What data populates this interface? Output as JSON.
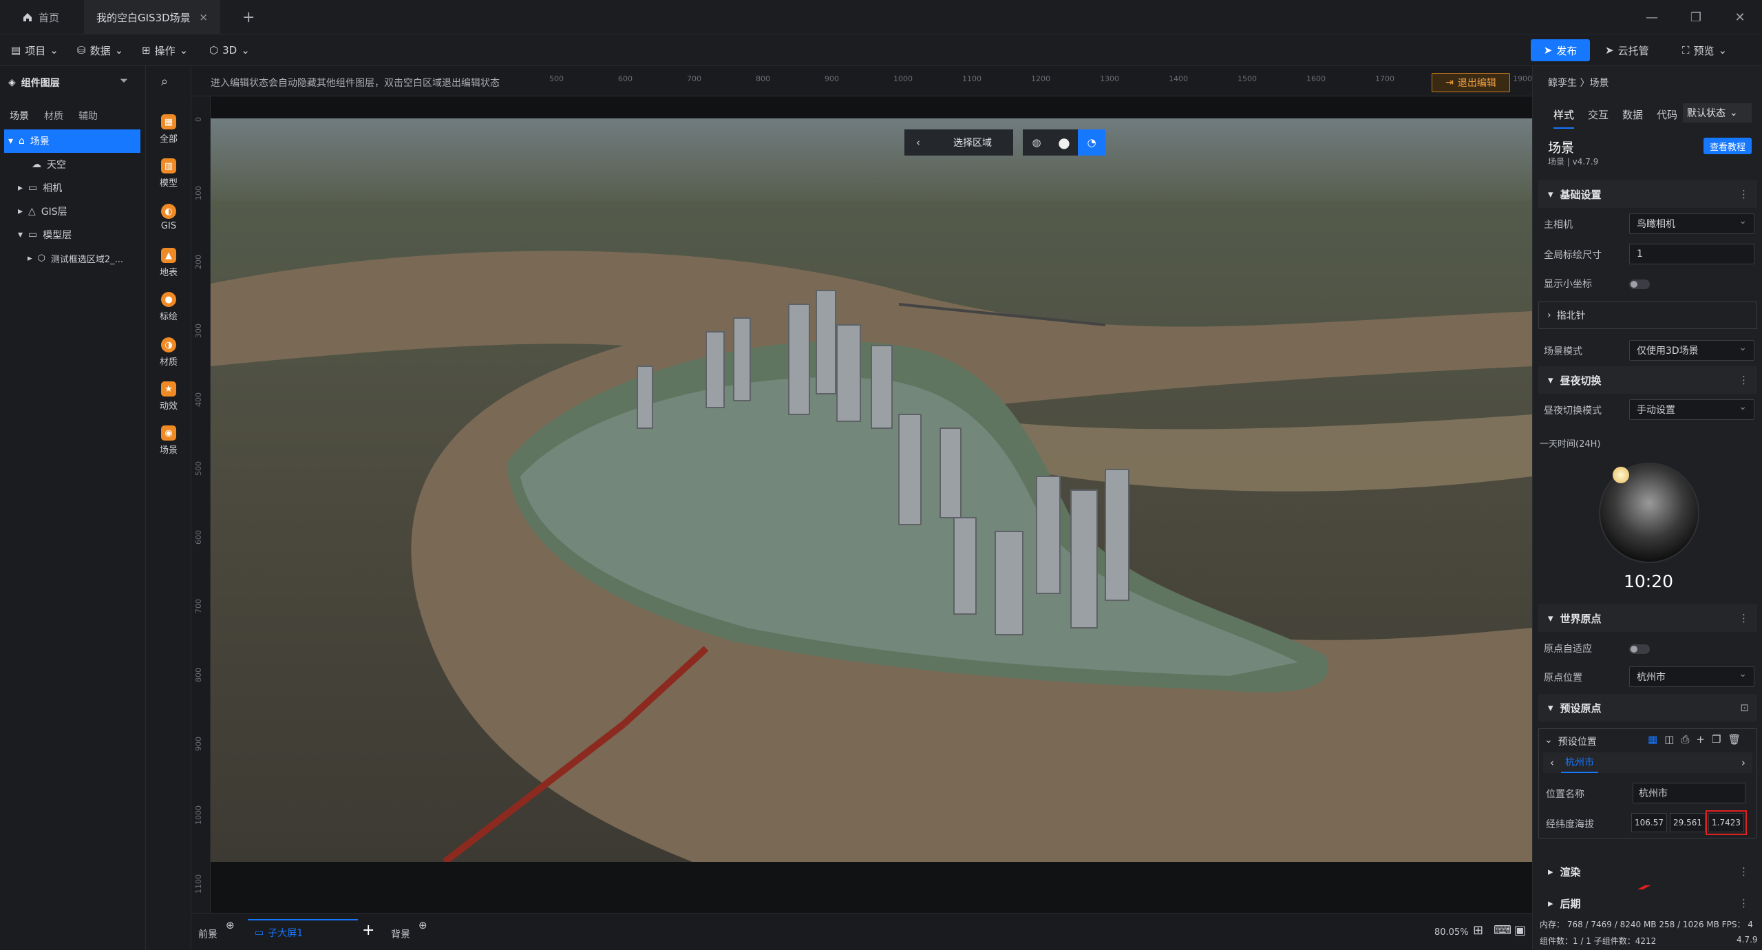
{
  "titlebar": {
    "tabs": [
      {
        "label": "首页"
      },
      {
        "label": "我的空白GIS3D场景"
      }
    ],
    "add_tab": "+"
  },
  "menubar": {
    "items": [
      {
        "label": "项目"
      },
      {
        "label": "数据"
      },
      {
        "label": "操作"
      },
      {
        "label": "3D"
      }
    ],
    "publish": "发布",
    "cloud": "云托管",
    "preview": "预览"
  },
  "left": {
    "title": "组件图层",
    "tabs": [
      "场景",
      "材质",
      "辅助"
    ],
    "tree": [
      {
        "label": "场景"
      },
      {
        "label": "天空"
      },
      {
        "label": "相机"
      },
      {
        "label": "GIS层"
      },
      {
        "label": "模型层"
      },
      {
        "label": "测试框选区域2_..."
      }
    ]
  },
  "iconbar": [
    {
      "label": "全部",
      "icon": "grid-icon"
    },
    {
      "label": "模型",
      "icon": "model-icon"
    },
    {
      "label": "GIS",
      "icon": "gis-icon"
    },
    {
      "label": "地表",
      "icon": "terrain-icon"
    },
    {
      "label": "标绘",
      "icon": "marker-icon"
    },
    {
      "label": "材质",
      "icon": "material-icon"
    },
    {
      "label": "动效",
      "icon": "effect-icon"
    },
    {
      "label": "场景",
      "icon": "scene-icon"
    }
  ],
  "canvas": {
    "hint": "进入编辑状态会自动隐藏其他组件图层，双击空白区域退出编辑状态",
    "exit_edit": "退出编辑",
    "select_area": "选择区域",
    "ruler_top": [
      "500",
      "600",
      "700",
      "800",
      "900",
      "1000",
      "1100",
      "1200",
      "1300",
      "1400",
      "1500",
      "1600",
      "1700",
      "1800",
      "1900"
    ],
    "ruler_left": [
      "0",
      "100",
      "200",
      "300",
      "400",
      "500",
      "600",
      "700",
      "800",
      "900",
      "1000",
      "1100"
    ]
  },
  "bottom": {
    "foreground": "前景",
    "screen": "子大屏1",
    "background": "背景",
    "zoom": "80.05%"
  },
  "right": {
    "breadcrumb": "鲸孪生 〉场景",
    "tabs": [
      "样式",
      "交互",
      "数据",
      "代码"
    ],
    "state": "默认状态",
    "title": "场景",
    "version": "场景 | v4.7.9",
    "tutorial": "查看教程",
    "sections": {
      "basic": "基础设置",
      "daynight": "昼夜切换",
      "world_origin": "世界原点",
      "preset_origin": "预设原点",
      "render": "渲染",
      "post": "后期"
    },
    "fields": {
      "main_camera_label": "主相机",
      "main_camera": "鸟瞰相机",
      "label_size_label": "全局标绘尺寸",
      "label_size": "1",
      "show_axis_label": "显示小坐标",
      "compass": "指北针",
      "scene_mode_label": "场景模式",
      "scene_mode": "仅使用3D场景",
      "daynight_mode_label": "昼夜切换模式",
      "daynight_mode": "手动设置",
      "time_label": "一天时间(24H)",
      "time": "10:20",
      "origin_auto_label": "原点自适应",
      "origin_pos_label": "原点位置",
      "origin_pos": "杭州市",
      "preset_pos": "预设位置",
      "preset_tab": "杭州市",
      "pos_name_label": "位置名称",
      "pos_name": "杭州市",
      "lonlat_label": "经纬度海拔",
      "lon": "106.57",
      "lat": "29.561",
      "alt": "1.7423"
    }
  },
  "status": {
    "memory": "内存： 768 / 7469 / 8240 MB  258 / 1026 MB  FPS： 4",
    "components": "组件数：1 / 1    子组件数：4212",
    "version": "4.7.9"
  }
}
